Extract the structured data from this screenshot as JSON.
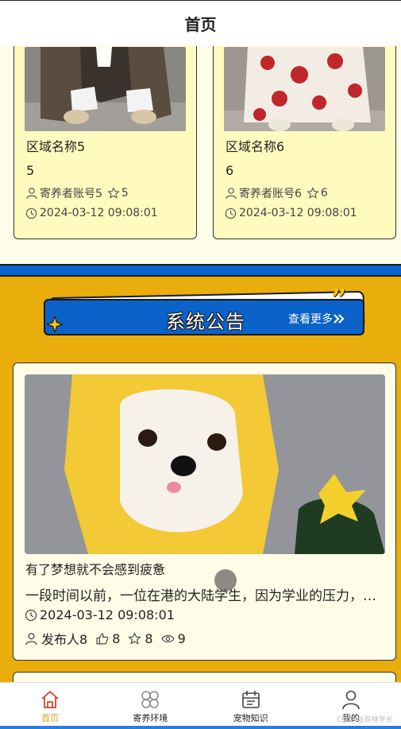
{
  "header": {
    "title": "首页"
  },
  "regions": [
    {
      "name": "区域名称5",
      "number": "5",
      "account": "寄养者账号5",
      "stars": "5",
      "time": "2024-03-12 09:08:01"
    },
    {
      "name": "区域名称6",
      "number": "6",
      "account": "寄养者账号6",
      "stars": "6",
      "time": "2024-03-12 09:08:01"
    }
  ],
  "notice_banner": {
    "title": "系统公告",
    "more": "查看更多",
    "more_icon": "double-chevron-right"
  },
  "notices": [
    {
      "title": "有了梦想就不会感到疲惫",
      "description": "一段时间以前，一位在港的大陆学生，因为学业的压力，感到非常疲惫",
      "time": "2024-03-12 09:08:01",
      "author": "发布人8",
      "likes": "8",
      "favorites": "8",
      "views": "9"
    }
  ],
  "tabbar": {
    "items": [
      {
        "label": "首页",
        "icon": "home-icon",
        "active": true
      },
      {
        "label": "寄养环境",
        "icon": "grid-icon",
        "active": false
      },
      {
        "label": "宠物知识",
        "icon": "calendar-icon",
        "active": false
      },
      {
        "label": "我的",
        "icon": "user-icon",
        "active": false
      }
    ]
  },
  "watermark": "CSDN@双林学长",
  "colors": {
    "accent": "#e9ad0c",
    "brand_blue": "#0b62c8",
    "card_bg": "#fffbbf",
    "active_tab": "#d9a11a"
  }
}
